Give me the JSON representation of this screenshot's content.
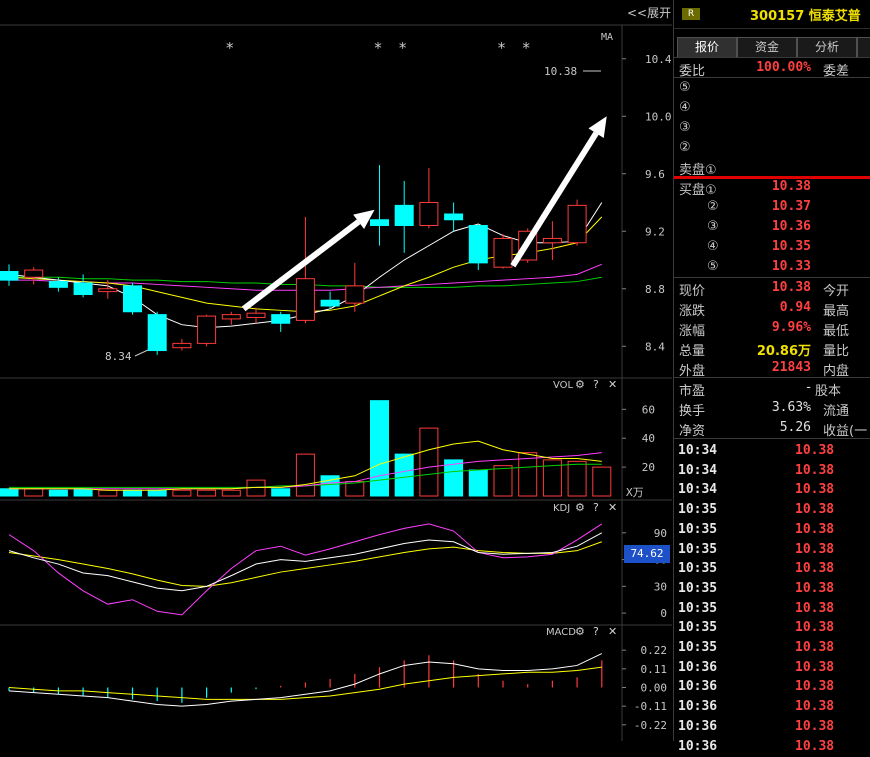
{
  "header": {
    "expand_label": "<<展开",
    "badge": "R",
    "stock": "300157 恒泰艾普"
  },
  "chart": {
    "ma_label": "MA",
    "max_label": "10.38",
    "min_label": "8.34",
    "price_axis": [
      "10.4",
      "10.0",
      "9.6",
      "9.2",
      "8.8",
      "8.4"
    ],
    "vol_label": "VOL",
    "vol_axis": [
      "60",
      "40",
      "20"
    ],
    "vol_unit": "X万",
    "kdj_label": "KDJ",
    "kdj_axis": [
      "90",
      "60",
      "30",
      "0"
    ],
    "kdj_value": "74.62",
    "macd_label": "MACD",
    "macd_axis": [
      "0.22",
      "0.11",
      "0.00",
      "-0.11",
      "-0.22"
    ],
    "gear_icon": "⚙",
    "help_icon": "?",
    "close_icon": "✕"
  },
  "chart_data": {
    "type": "candlestick",
    "price_ylim": [
      8.2,
      10.6
    ],
    "candles": [
      {
        "o": 8.92,
        "h": 8.97,
        "l": 8.82,
        "c": 8.86
      },
      {
        "o": 8.88,
        "h": 8.95,
        "l": 8.83,
        "c": 8.93
      },
      {
        "o": 8.85,
        "h": 8.88,
        "l": 8.78,
        "c": 8.81
      },
      {
        "o": 8.84,
        "h": 8.9,
        "l": 8.74,
        "c": 8.76
      },
      {
        "o": 8.78,
        "h": 8.86,
        "l": 8.73,
        "c": 8.8
      },
      {
        "o": 8.82,
        "h": 8.84,
        "l": 8.62,
        "c": 8.64
      },
      {
        "o": 8.62,
        "h": 8.64,
        "l": 8.34,
        "c": 8.37
      },
      {
        "o": 8.39,
        "h": 8.45,
        "l": 8.37,
        "c": 8.42
      },
      {
        "o": 8.42,
        "h": 8.62,
        "l": 8.4,
        "c": 8.61
      },
      {
        "o": 8.59,
        "h": 8.64,
        "l": 8.55,
        "c": 8.62
      },
      {
        "o": 8.6,
        "h": 8.67,
        "l": 8.56,
        "c": 8.63
      },
      {
        "o": 8.62,
        "h": 8.64,
        "l": 8.5,
        "c": 8.56
      },
      {
        "o": 8.58,
        "h": 9.3,
        "l": 8.56,
        "c": 8.87
      },
      {
        "o": 8.72,
        "h": 8.78,
        "l": 8.66,
        "c": 8.68
      },
      {
        "o": 8.7,
        "h": 8.98,
        "l": 8.64,
        "c": 8.82
      },
      {
        "o": 9.28,
        "h": 9.66,
        "l": 9.1,
        "c": 9.24
      },
      {
        "o": 9.38,
        "h": 9.55,
        "l": 9.05,
        "c": 9.24
      },
      {
        "o": 9.24,
        "h": 9.64,
        "l": 9.22,
        "c": 9.4
      },
      {
        "o": 9.32,
        "h": 9.4,
        "l": 9.2,
        "c": 9.28
      },
      {
        "o": 9.24,
        "h": 9.24,
        "l": 8.93,
        "c": 8.98
      },
      {
        "o": 8.95,
        "h": 9.18,
        "l": 8.94,
        "c": 9.15
      },
      {
        "o": 9.0,
        "h": 9.22,
        "l": 8.98,
        "c": 9.2
      },
      {
        "o": 9.12,
        "h": 9.27,
        "l": 9.0,
        "c": 9.15
      },
      {
        "o": 9.12,
        "h": 9.42,
        "l": 9.1,
        "c": 9.38
      }
    ],
    "ma5": [
      8.9,
      8.88,
      8.86,
      8.84,
      8.82,
      8.74,
      8.62,
      8.55,
      8.53,
      8.54,
      8.56,
      8.58,
      8.62,
      8.66,
      8.75,
      8.88,
      9.0,
      9.1,
      9.2,
      9.25,
      9.17,
      9.12,
      9.12,
      9.13,
      9.4
    ],
    "ma10": [
      8.88,
      8.87,
      8.86,
      8.85,
      8.84,
      8.82,
      8.78,
      8.74,
      8.7,
      8.68,
      8.66,
      8.65,
      8.64,
      8.65,
      8.68,
      8.75,
      8.82,
      8.88,
      8.95,
      9.0,
      9.03,
      9.05,
      9.08,
      9.12,
      9.3
    ],
    "ma20": [
      8.86,
      8.86,
      8.85,
      8.85,
      8.84,
      8.84,
      8.83,
      8.82,
      8.81,
      8.8,
      8.79,
      8.79,
      8.79,
      8.79,
      8.8,
      8.81,
      8.82,
      8.83,
      8.84,
      8.85,
      8.86,
      8.87,
      8.88,
      8.9,
      8.97
    ],
    "ma60": [
      8.88,
      8.88,
      8.88,
      8.87,
      8.87,
      8.86,
      8.86,
      8.85,
      8.85,
      8.84,
      8.84,
      8.83,
      8.83,
      8.82,
      8.82,
      8.81,
      8.81,
      8.81,
      8.81,
      8.82,
      8.82,
      8.83,
      8.84,
      8.85,
      8.88
    ],
    "star_positions": [
      9,
      15,
      16,
      20,
      21
    ],
    "volume": [
      5,
      5,
      4,
      5,
      4,
      4,
      4,
      4,
      4,
      4,
      11,
      5,
      29,
      14,
      10,
      66,
      29,
      47,
      25,
      18,
      21,
      30,
      25,
      24,
      20
    ],
    "vol_ylim": [
      0,
      72
    ],
    "vol_ma1": [
      5,
      5,
      5,
      5,
      4,
      4,
      4,
      5,
      5,
      5,
      6,
      6,
      8,
      11,
      14,
      22,
      27,
      32,
      36,
      38,
      32,
      29,
      26,
      26,
      24
    ],
    "vol_ma2": [
      5,
      5,
      5,
      5,
      5,
      5,
      5,
      5,
      5,
      5,
      6,
      6,
      7,
      9,
      10,
      14,
      17,
      20,
      22,
      24,
      25,
      26,
      27,
      28,
      30
    ],
    "vol_ma3": [
      6,
      6,
      6,
      6,
      6,
      6,
      6,
      6,
      6,
      6,
      6,
      7,
      7,
      8,
      9,
      11,
      13,
      15,
      17,
      18,
      19,
      20,
      21,
      22,
      22
    ],
    "kdj_ylim": [
      -10,
      110
    ],
    "kdj_k": [
      70,
      62,
      55,
      45,
      42,
      35,
      28,
      25,
      30,
      42,
      55,
      60,
      58,
      62,
      66,
      72,
      78,
      82,
      80,
      68,
      66,
      67,
      68,
      75,
      90
    ],
    "kdj_d": [
      68,
      64,
      60,
      55,
      50,
      44,
      37,
      31,
      30,
      34,
      40,
      46,
      50,
      54,
      58,
      63,
      68,
      72,
      74,
      70,
      68,
      67,
      67,
      70,
      80
    ],
    "kdj_j": [
      88,
      70,
      45,
      25,
      10,
      15,
      2,
      -2,
      25,
      50,
      70,
      75,
      65,
      72,
      80,
      88,
      95,
      100,
      92,
      68,
      62,
      63,
      66,
      82,
      100
    ],
    "macd_ylim": [
      -0.28,
      0.28
    ],
    "macd_dif": [
      -0.02,
      -0.03,
      -0.04,
      -0.05,
      -0.06,
      -0.08,
      -0.1,
      -0.11,
      -0.1,
      -0.08,
      -0.07,
      -0.06,
      -0.04,
      -0.02,
      0.02,
      0.08,
      0.13,
      0.15,
      0.14,
      0.11,
      0.1,
      0.1,
      0.11,
      0.13,
      0.2
    ],
    "macd_dea": [
      0.0,
      -0.01,
      -0.02,
      -0.02,
      -0.03,
      -0.04,
      -0.05,
      -0.06,
      -0.07,
      -0.07,
      -0.07,
      -0.07,
      -0.06,
      -0.05,
      -0.03,
      -0.01,
      0.02,
      0.04,
      0.06,
      0.07,
      0.08,
      0.09,
      0.09,
      0.1,
      0.12
    ],
    "macd_hist": [
      -0.02,
      -0.03,
      -0.04,
      -0.05,
      -0.06,
      -0.07,
      -0.08,
      -0.09,
      -0.06,
      -0.03,
      -0.01,
      0.01,
      0.03,
      0.05,
      0.08,
      0.12,
      0.16,
      0.19,
      0.16,
      0.08,
      0.04,
      0.02,
      0.04,
      0.06,
      0.16
    ],
    "arrows": [
      {
        "from": [
          9.5,
          8.66
        ],
        "to": [
          14.8,
          9.35
        ]
      },
      {
        "from": [
          20.4,
          8.96
        ],
        "to": [
          24.2,
          10.0
        ]
      }
    ]
  },
  "quote": {
    "tabs": [
      "报价",
      "资金",
      "分析",
      ""
    ],
    "weibi_label": "委比",
    "weibi_value": "100.00%",
    "weicha_label": "委差",
    "sell_labels": [
      "⑤",
      "④",
      "③",
      "②",
      "卖盘①"
    ],
    "buy_labels": [
      "买盘①",
      "②",
      "③",
      "④",
      "⑤"
    ],
    "buy_prices": [
      "10.38",
      "10.37",
      "10.36",
      "10.35",
      "10.33"
    ],
    "stats": [
      {
        "label": "现价",
        "value": "10.38",
        "label2": "今开",
        "color": "red"
      },
      {
        "label": "涨跌",
        "value": "0.94",
        "label2": "最高",
        "color": "red"
      },
      {
        "label": "涨幅",
        "value": "9.96%",
        "label2": "最低",
        "color": "red"
      },
      {
        "label": "总量",
        "value": "20.86万",
        "label2": "量比",
        "color": "yel"
      },
      {
        "label": "外盘",
        "value": "21843",
        "label2": "内盘",
        "color": "red"
      }
    ],
    "fund": [
      {
        "label": "市盈",
        "value": "-",
        "label2": "股本"
      },
      {
        "label": "换手",
        "value": "3.63%",
        "label2": "流通"
      },
      {
        "label": "净资",
        "value": "5.26",
        "label2": "收益(一"
      }
    ],
    "ticks": [
      {
        "time": "10:34",
        "price": "10.38"
      },
      {
        "time": "10:34",
        "price": "10.38"
      },
      {
        "time": "10:34",
        "price": "10.38"
      },
      {
        "time": "10:35",
        "price": "10.38"
      },
      {
        "time": "10:35",
        "price": "10.38"
      },
      {
        "time": "10:35",
        "price": "10.38"
      },
      {
        "time": "10:35",
        "price": "10.38"
      },
      {
        "time": "10:35",
        "price": "10.38"
      },
      {
        "time": "10:35",
        "price": "10.38"
      },
      {
        "time": "10:35",
        "price": "10.38"
      },
      {
        "time": "10:35",
        "price": "10.38"
      },
      {
        "time": "10:36",
        "price": "10.38"
      },
      {
        "time": "10:36",
        "price": "10.38"
      },
      {
        "time": "10:36",
        "price": "10.38"
      },
      {
        "time": "10:36",
        "price": "10.38"
      },
      {
        "time": "10:36",
        "price": "10.38"
      }
    ]
  },
  "colors": {
    "up": "#ff3a3a",
    "down": "#00ffff",
    "ma5": "#ffffff",
    "ma10": "#ffff00",
    "ma20": "#ff40ff",
    "ma60": "#00d000",
    "arrow": "#ffffff"
  }
}
